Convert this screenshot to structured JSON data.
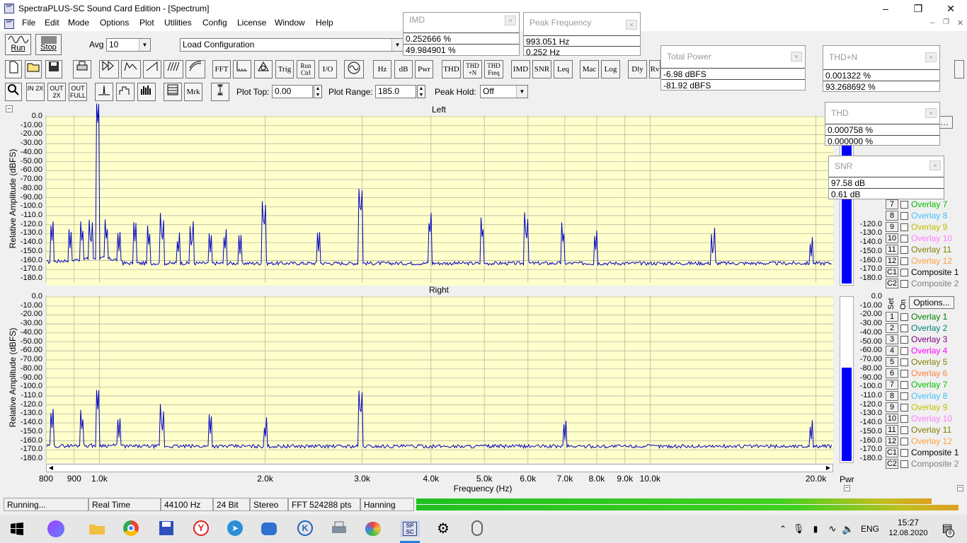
{
  "window": {
    "title": "SpectraPLUS-SC Sound Card Edition - [Spectrum]"
  },
  "menu": [
    "File",
    "Edit",
    "Mode",
    "Options",
    "Plot",
    "Utilities",
    "Config",
    "License",
    "Window",
    "Help"
  ],
  "toolbar1": {
    "run": "Run",
    "stop": "Stop",
    "avg_label": "Avg",
    "avg_value": "10",
    "load_config": "Load Configuration"
  },
  "toolbar2": {
    "buttons": [
      "FFT",
      "Trig",
      "Run Ctrl",
      "I/O",
      "Hz",
      "dB",
      "Pwr",
      "THD",
      "THD +N",
      "THD Freq",
      "IMD",
      "SNR",
      "Leq",
      "Mac",
      "Log",
      "Dly",
      "Rv"
    ]
  },
  "toolbar3": {
    "zoom_in": "IN 2X",
    "zoom_out": "OUT 2X",
    "zoom_full": "OUT FULL",
    "mrk": "Mrk",
    "plot_top_label": "Plot Top:",
    "plot_top": "0.00",
    "plot_range_label": "Plot Range:",
    "plot_range": "185.0",
    "peak_hold_label": "Peak Hold:",
    "peak_hold": "Off"
  },
  "meters": {
    "imd": {
      "title": "IMD",
      "v1": "0.252666 %",
      "v2": "49.984901 %"
    },
    "peak": {
      "title": "Peak Frequency",
      "v1": "993.051 Hz",
      "v2": " 0.252 Hz"
    },
    "power": {
      "title": "Total Power",
      "v1": "-6.98 dBFS",
      "v2": "-81.92 dBFS"
    },
    "thdn": {
      "title": "THD+N",
      "v1": "0.001322 %",
      "v2": "93.268692 %"
    },
    "thd": {
      "title": "THD",
      "v1": "0.000758 %",
      "v2": "0.000000 %"
    },
    "snr": {
      "title": "SNR",
      "v1": "97.58 dB",
      "v2": "  0.61 dB"
    }
  },
  "plots": {
    "left_title": "Left",
    "right_title": "Right",
    "ylabel": "Relative Amplitude (dBFS)",
    "yticks": [
      "0.0",
      "-10.00",
      "-20.00",
      "-30.00",
      "-40.00",
      "-50.00",
      "-60.00",
      "-70.00",
      "-80.00",
      "-90.00",
      "-100.0",
      "-110.0",
      "-120.0",
      "-130.0",
      "-140.0",
      "-150.0",
      "-160.0",
      "-170.0",
      "-180.0"
    ],
    "xlabel": "Frequency (Hz)",
    "xticks": [
      "800",
      "900",
      "1.0k",
      "2.0k",
      "3.0k",
      "4.0k",
      "5.0k",
      "6.0k",
      "7.0k",
      "8.0k",
      "9.0k",
      "10.0k",
      "20.0k"
    ],
    "pwr": "Pwr"
  },
  "overlay_panel": {
    "set": "Set",
    "on": "On",
    "options": "Options...",
    "items": [
      {
        "n": "1",
        "label": "Overlay 1",
        "color": "#008000"
      },
      {
        "n": "2",
        "label": "Overlay 2",
        "color": "#008080"
      },
      {
        "n": "3",
        "label": "Overlay 3",
        "color": "#800080"
      },
      {
        "n": "4",
        "label": "Overlay 4",
        "color": "#ff00ff"
      },
      {
        "n": "5",
        "label": "Overlay 5",
        "color": "#808000"
      },
      {
        "n": "6",
        "label": "Overlay 6",
        "color": "#ff8040"
      },
      {
        "n": "7",
        "label": "Overlay 7",
        "color": "#00c000"
      },
      {
        "n": "8",
        "label": "Overlay 8",
        "color": "#40c0ff"
      },
      {
        "n": "9",
        "label": "Overlay 9",
        "color": "#c0c000"
      },
      {
        "n": "10",
        "label": "Overlay 10",
        "color": "#ff80ff"
      },
      {
        "n": "11",
        "label": "Overlay 11",
        "color": "#808000"
      },
      {
        "n": "12",
        "label": "Overlay 12",
        "color": "#ffa040"
      },
      {
        "n": "C1",
        "label": "Composite 1",
        "color": "#000000"
      },
      {
        "n": "C2",
        "label": "Composite 2",
        "color": "#808080"
      }
    ]
  },
  "spectrum": {
    "left": {
      "noise": -163,
      "peaks": [
        [
          820,
          -140
        ],
        [
          885,
          -148
        ],
        [
          930,
          -143
        ],
        [
          965,
          -148
        ],
        [
          993,
          -7
        ],
        [
          1030,
          -141
        ],
        [
          1085,
          -150
        ],
        [
          1160,
          -139
        ],
        [
          1230,
          -147
        ],
        [
          1300,
          -143
        ],
        [
          1390,
          -155
        ],
        [
          1470,
          -151
        ],
        [
          1590,
          -152
        ],
        [
          1690,
          -151
        ],
        [
          1800,
          -153
        ],
        [
          1990,
          -128
        ],
        [
          2500,
          -150
        ],
        [
          2980,
          -113
        ],
        [
          3980,
          -134
        ],
        [
          4960,
          -140
        ],
        [
          5960,
          -142
        ],
        [
          6950,
          -145
        ],
        [
          7960,
          -151
        ],
        [
          13000,
          -159
        ],
        [
          19600,
          -159
        ]
      ]
    },
    "right": {
      "noise": -166,
      "peaks": [
        [
          820,
          -148
        ],
        [
          930,
          -152
        ],
        [
          993,
          -125
        ],
        [
          1085,
          -157
        ],
        [
          1300,
          -155
        ],
        [
          1590,
          -153
        ],
        [
          2000,
          -161
        ],
        [
          2980,
          -137
        ],
        [
          7000,
          -161
        ],
        [
          19600,
          -162
        ]
      ]
    }
  },
  "status": {
    "state": "Running...",
    "mode": "Real Time",
    "rate": "44100 Hz",
    "bits": "24 Bit",
    "channels": "Stereo",
    "fft": "FFT 524288 pts",
    "window": "Hanning"
  },
  "taskbar": {
    "lang": "ENG",
    "time": "15:27",
    "date": "12.08.2020",
    "notif": "8"
  }
}
